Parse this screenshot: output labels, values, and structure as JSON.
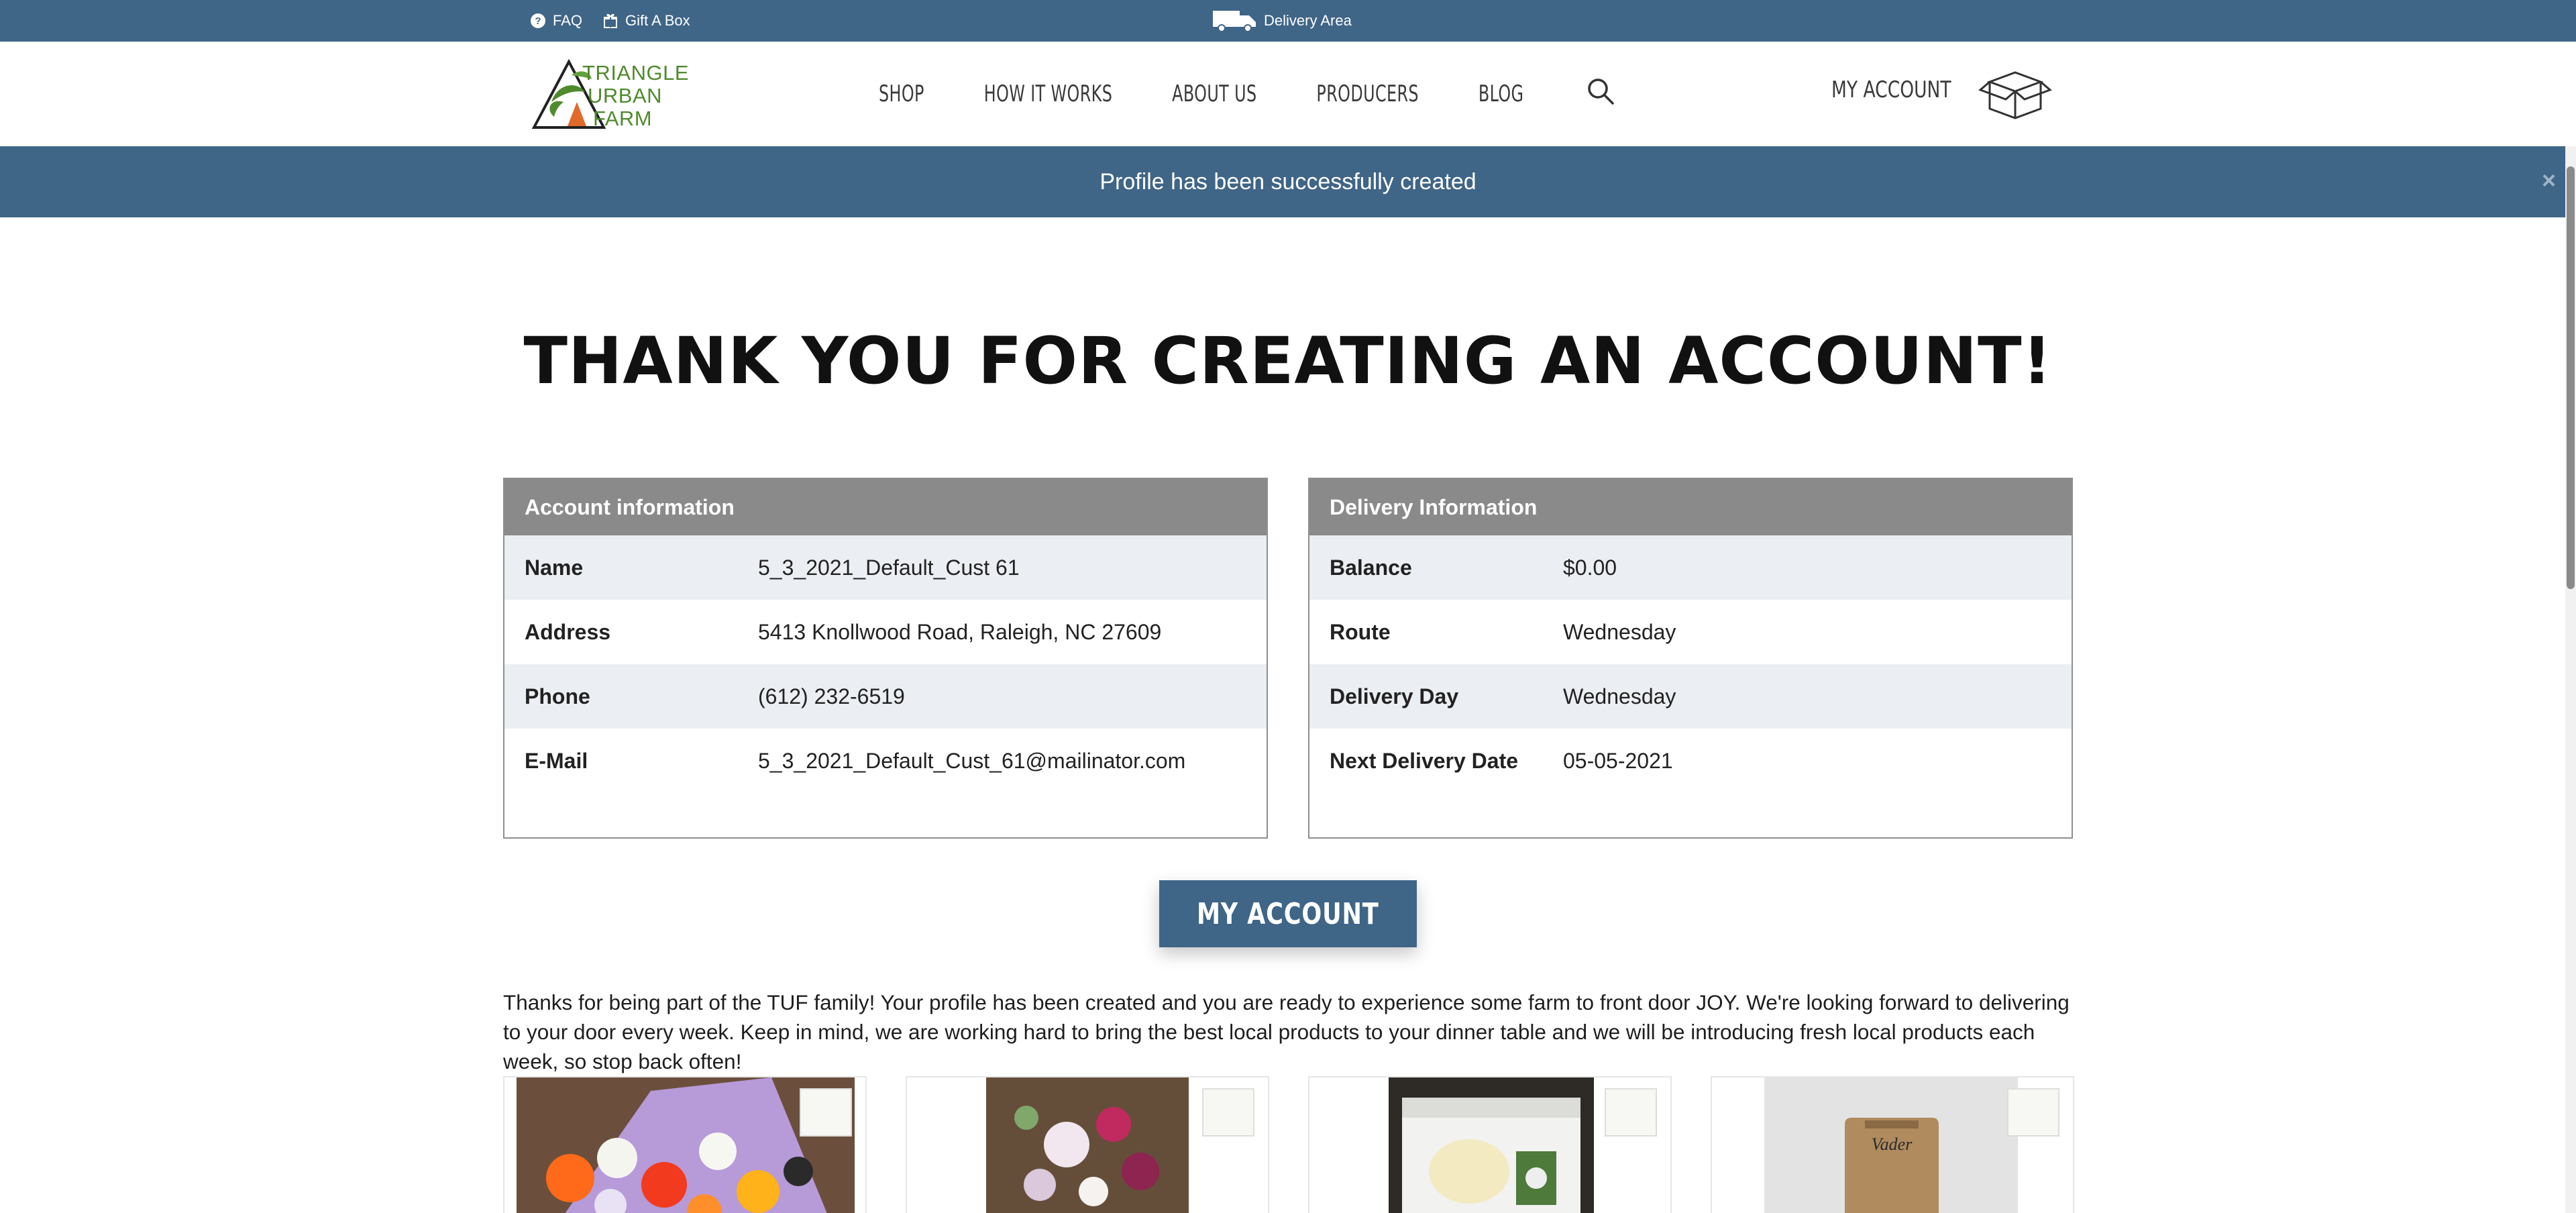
{
  "topbar": {
    "faq_label": "FAQ",
    "gift_label": "Gift A Box",
    "delivery_label": "Delivery Area"
  },
  "brand": {
    "logo_line1": "TRIANGLE",
    "logo_line2": "URBAN",
    "logo_line3": "FARM",
    "logo_color": "#4f8a2c",
    "primary_color": "#3f6587"
  },
  "nav": {
    "items": [
      "SHOP",
      "HOW IT WORKS",
      "ABOUT US",
      "PRODUCERS",
      "BLOG"
    ],
    "my_account": "MY ACCOUNT",
    "search_icon": "search-icon",
    "cart_icon": "box-icon"
  },
  "alert": {
    "message": "Profile has been successfully created",
    "close": "×"
  },
  "page": {
    "title": "THANK YOU FOR CREATING AN ACCOUNT!"
  },
  "account": {
    "heading": "Account information",
    "rows": [
      {
        "label": "Name",
        "value": "5_3_2021_Default_Cust 61"
      },
      {
        "label": "Address",
        "value": "5413 Knollwood Road, Raleigh, NC 27609"
      },
      {
        "label": "Phone",
        "value": "(612) 232-6519"
      },
      {
        "label": "E-Mail",
        "value": "5_3_2021_Default_Cust_61@mailinator.com"
      }
    ]
  },
  "delivery": {
    "heading": "Delivery Information",
    "rows": [
      {
        "label": "Balance",
        "value": "$0.00"
      },
      {
        "label": "Route",
        "value": "Wednesday"
      },
      {
        "label": "Delivery Day",
        "value": "Wednesday"
      },
      {
        "label": "Next Delivery Date",
        "value": "05-05-2021"
      }
    ]
  },
  "cta": {
    "label": "MY ACCOUNT"
  },
  "intro": {
    "text": "Thanks for being part of the TUF family!  Your profile has been created and you are ready to experience some farm to front door JOY.  We're looking forward to delivering to your door every week. Keep in mind, we are working hard to bring the best local products to your dinner table and we will be introducing fresh local products each week, so stop back often!"
  },
  "products": [
    {
      "icon": "flower-bouquet-image"
    },
    {
      "icon": "flower-vase-image"
    },
    {
      "icon": "gift-box-image"
    },
    {
      "icon": "coffee-bag-image"
    }
  ]
}
